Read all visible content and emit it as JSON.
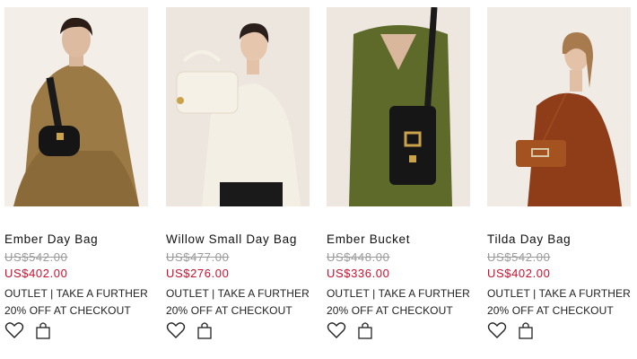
{
  "products": [
    {
      "name": "Ember Day Bag",
      "original_price": "US$542.00",
      "sale_price": "US$402.00",
      "promo_line1": "OUTLET | TAKE A FURTHER",
      "promo_line2": "20% OFF AT CHECKOUT",
      "image_bg": "#f3eee8"
    },
    {
      "name": "Willow Small Day Bag",
      "original_price": "US$477.00",
      "sale_price": "US$276.00",
      "promo_line1": "OUTLET | TAKE A FURTHER",
      "promo_line2": "20% OFF AT CHECKOUT",
      "image_bg": "#ece6df"
    },
    {
      "name": "Ember Bucket",
      "original_price": "US$448.00",
      "sale_price": "US$336.00",
      "promo_line1": "OUTLET | TAKE A FURTHER",
      "promo_line2": "20% OFF AT CHECKOUT",
      "image_bg": "#ede7e0"
    },
    {
      "name": "Tilda Day Bag",
      "original_price": "US$542.00",
      "sale_price": "US$402.00",
      "promo_line1": "OUTLET | TAKE A FURTHER",
      "promo_line2": "20% OFF AT CHECKOUT",
      "image_bg": "#f0ebe5"
    }
  ],
  "icons": {
    "wishlist": "heart-icon",
    "cart": "shopping-bag-icon"
  },
  "colors": {
    "sale_price": "#c8102e",
    "original_price": "#9a9a9a"
  }
}
